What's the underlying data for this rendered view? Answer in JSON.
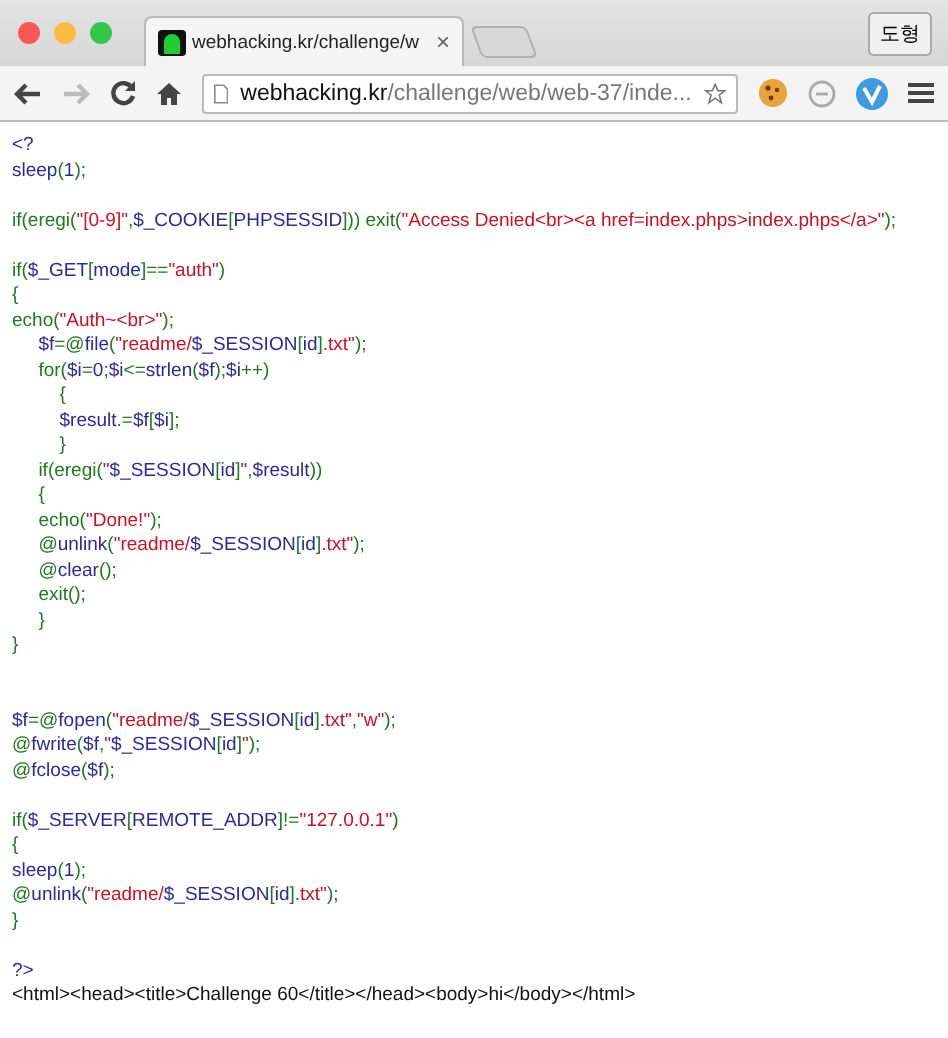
{
  "window": {
    "tab_title": "webhacking.kr/challenge/w",
    "tab_close": "×",
    "profile_button": "도형"
  },
  "toolbar": {
    "url_domain": "webhacking.kr",
    "url_path": "/challenge/web/web-37/inde..."
  },
  "code_lines": [
    {
      "kind": "code",
      "segs": [
        {
          "text": "<?",
          "kind": "ident"
        }
      ]
    },
    {
      "kind": "code",
      "segs": [
        {
          "text": "sleep",
          "kind": "ident"
        },
        {
          "text": "(",
          "kind": "keyword"
        },
        {
          "text": "1",
          "kind": "ident"
        },
        {
          "text": ");",
          "kind": "keyword"
        }
      ]
    },
    {
      "kind": "blank"
    },
    {
      "kind": "code",
      "segs": [
        {
          "text": "if(eregi(",
          "kind": "keyword"
        },
        {
          "text": "\"[0-9]\"",
          "kind": "string"
        },
        {
          "text": ",",
          "kind": "keyword"
        },
        {
          "text": "$_COOKIE",
          "kind": "ident"
        },
        {
          "text": "[",
          "kind": "keyword"
        },
        {
          "text": "PHPSESSID",
          "kind": "ident"
        },
        {
          "text": "])) exit(",
          "kind": "keyword"
        },
        {
          "text": "\"Access Denied<br><a href=index.phps>index.phps</a>\"",
          "kind": "string"
        },
        {
          "text": ");",
          "kind": "keyword"
        }
      ]
    },
    {
      "kind": "blank"
    },
    {
      "kind": "code",
      "segs": [
        {
          "text": "if(",
          "kind": "keyword"
        },
        {
          "text": "$_GET",
          "kind": "ident"
        },
        {
          "text": "[",
          "kind": "keyword"
        },
        {
          "text": "mode",
          "kind": "ident"
        },
        {
          "text": "]==",
          "kind": "keyword"
        },
        {
          "text": "\"auth\"",
          "kind": "string"
        },
        {
          "text": ")",
          "kind": "keyword"
        }
      ]
    },
    {
      "kind": "code",
      "segs": [
        {
          "text": "{",
          "kind": "keyword"
        }
      ]
    },
    {
      "kind": "code",
      "segs": [
        {
          "text": "echo(",
          "kind": "keyword"
        },
        {
          "text": "\"Auth~<br>\"",
          "kind": "string"
        },
        {
          "text": ");",
          "kind": "keyword"
        }
      ]
    },
    {
      "kind": "code",
      "segs": [
        {
          "text": "     $f",
          "kind": "ident"
        },
        {
          "text": "=@",
          "kind": "keyword"
        },
        {
          "text": "file",
          "kind": "ident"
        },
        {
          "text": "(",
          "kind": "keyword"
        },
        {
          "text": "\"readme/",
          "kind": "string"
        },
        {
          "text": "$_SESSION",
          "kind": "ident"
        },
        {
          "text": "[",
          "kind": "keyword"
        },
        {
          "text": "id",
          "kind": "ident"
        },
        {
          "text": "]",
          "kind": "keyword"
        },
        {
          "text": ".txt\"",
          "kind": "string"
        },
        {
          "text": ");",
          "kind": "keyword"
        }
      ]
    },
    {
      "kind": "code",
      "segs": [
        {
          "text": "     for(",
          "kind": "keyword"
        },
        {
          "text": "$i",
          "kind": "ident"
        },
        {
          "text": "=",
          "kind": "keyword"
        },
        {
          "text": "0",
          "kind": "ident"
        },
        {
          "text": ";",
          "kind": "keyword"
        },
        {
          "text": "$i",
          "kind": "ident"
        },
        {
          "text": "<=",
          "kind": "keyword"
        },
        {
          "text": "strlen",
          "kind": "ident"
        },
        {
          "text": "(",
          "kind": "keyword"
        },
        {
          "text": "$f",
          "kind": "ident"
        },
        {
          "text": ");",
          "kind": "keyword"
        },
        {
          "text": "$i",
          "kind": "ident"
        },
        {
          "text": "++)",
          "kind": "keyword"
        }
      ]
    },
    {
      "kind": "code",
      "segs": [
        {
          "text": "         {",
          "kind": "keyword"
        }
      ]
    },
    {
      "kind": "code",
      "segs": [
        {
          "text": "         $result",
          "kind": "ident"
        },
        {
          "text": ".=",
          "kind": "keyword"
        },
        {
          "text": "$f",
          "kind": "ident"
        },
        {
          "text": "[",
          "kind": "keyword"
        },
        {
          "text": "$i",
          "kind": "ident"
        },
        {
          "text": "];",
          "kind": "keyword"
        }
      ]
    },
    {
      "kind": "code",
      "segs": [
        {
          "text": "         }",
          "kind": "keyword"
        }
      ]
    },
    {
      "kind": "code",
      "segs": [
        {
          "text": "     if(eregi(",
          "kind": "keyword"
        },
        {
          "text": "\"",
          "kind": "string"
        },
        {
          "text": "$_SESSION",
          "kind": "ident"
        },
        {
          "text": "[",
          "kind": "keyword"
        },
        {
          "text": "id",
          "kind": "ident"
        },
        {
          "text": "]",
          "kind": "keyword"
        },
        {
          "text": "\"",
          "kind": "string"
        },
        {
          "text": ",",
          "kind": "keyword"
        },
        {
          "text": "$result",
          "kind": "ident"
        },
        {
          "text": "))",
          "kind": "keyword"
        }
      ]
    },
    {
      "kind": "code",
      "segs": [
        {
          "text": "     {",
          "kind": "keyword"
        }
      ]
    },
    {
      "kind": "code",
      "segs": [
        {
          "text": "     echo(",
          "kind": "keyword"
        },
        {
          "text": "\"Done!\"",
          "kind": "string"
        },
        {
          "text": ");",
          "kind": "keyword"
        }
      ]
    },
    {
      "kind": "code",
      "segs": [
        {
          "text": "     @",
          "kind": "keyword"
        },
        {
          "text": "unlink",
          "kind": "ident"
        },
        {
          "text": "(",
          "kind": "keyword"
        },
        {
          "text": "\"readme/",
          "kind": "string"
        },
        {
          "text": "$_SESSION",
          "kind": "ident"
        },
        {
          "text": "[",
          "kind": "keyword"
        },
        {
          "text": "id",
          "kind": "ident"
        },
        {
          "text": "]",
          "kind": "keyword"
        },
        {
          "text": ".txt\"",
          "kind": "string"
        },
        {
          "text": ");",
          "kind": "keyword"
        }
      ]
    },
    {
      "kind": "code",
      "segs": [
        {
          "text": "     @",
          "kind": "keyword"
        },
        {
          "text": "clear",
          "kind": "ident"
        },
        {
          "text": "();",
          "kind": "keyword"
        }
      ]
    },
    {
      "kind": "code",
      "segs": [
        {
          "text": "     exit();",
          "kind": "keyword"
        }
      ]
    },
    {
      "kind": "code",
      "segs": [
        {
          "text": "     }",
          "kind": "keyword"
        }
      ]
    },
    {
      "kind": "code",
      "segs": [
        {
          "text": "}",
          "kind": "keyword"
        }
      ]
    },
    {
      "kind": "blank"
    },
    {
      "kind": "blank"
    },
    {
      "kind": "code",
      "segs": [
        {
          "text": "$f",
          "kind": "ident"
        },
        {
          "text": "=@",
          "kind": "keyword"
        },
        {
          "text": "fopen",
          "kind": "ident"
        },
        {
          "text": "(",
          "kind": "keyword"
        },
        {
          "text": "\"readme/",
          "kind": "string"
        },
        {
          "text": "$_SESSION",
          "kind": "ident"
        },
        {
          "text": "[",
          "kind": "keyword"
        },
        {
          "text": "id",
          "kind": "ident"
        },
        {
          "text": "]",
          "kind": "keyword"
        },
        {
          "text": ".txt\"",
          "kind": "string"
        },
        {
          "text": ",",
          "kind": "keyword"
        },
        {
          "text": "\"w\"",
          "kind": "string"
        },
        {
          "text": ");",
          "kind": "keyword"
        }
      ]
    },
    {
      "kind": "code",
      "segs": [
        {
          "text": "@",
          "kind": "keyword"
        },
        {
          "text": "fwrite",
          "kind": "ident"
        },
        {
          "text": "(",
          "kind": "keyword"
        },
        {
          "text": "$f",
          "kind": "ident"
        },
        {
          "text": ",",
          "kind": "keyword"
        },
        {
          "text": "\"",
          "kind": "string"
        },
        {
          "text": "$_SESSION",
          "kind": "ident"
        },
        {
          "text": "[",
          "kind": "keyword"
        },
        {
          "text": "id",
          "kind": "ident"
        },
        {
          "text": "]",
          "kind": "keyword"
        },
        {
          "text": "\"",
          "kind": "string"
        },
        {
          "text": ");",
          "kind": "keyword"
        }
      ]
    },
    {
      "kind": "code",
      "segs": [
        {
          "text": "@",
          "kind": "keyword"
        },
        {
          "text": "fclose",
          "kind": "ident"
        },
        {
          "text": "(",
          "kind": "keyword"
        },
        {
          "text": "$f",
          "kind": "ident"
        },
        {
          "text": ");",
          "kind": "keyword"
        }
      ]
    },
    {
      "kind": "blank"
    },
    {
      "kind": "code",
      "segs": [
        {
          "text": "if(",
          "kind": "keyword"
        },
        {
          "text": "$_SERVER",
          "kind": "ident"
        },
        {
          "text": "[",
          "kind": "keyword"
        },
        {
          "text": "REMOTE_ADDR",
          "kind": "ident"
        },
        {
          "text": "]!=",
          "kind": "keyword"
        },
        {
          "text": "\"127.0.0.1\"",
          "kind": "string"
        },
        {
          "text": ")",
          "kind": "keyword"
        }
      ]
    },
    {
      "kind": "code",
      "segs": [
        {
          "text": "{",
          "kind": "keyword"
        }
      ]
    },
    {
      "kind": "code",
      "segs": [
        {
          "text": "sleep",
          "kind": "ident"
        },
        {
          "text": "(",
          "kind": "keyword"
        },
        {
          "text": "1",
          "kind": "ident"
        },
        {
          "text": ");",
          "kind": "keyword"
        }
      ]
    },
    {
      "kind": "code",
      "segs": [
        {
          "text": "@",
          "kind": "keyword"
        },
        {
          "text": "unlink",
          "kind": "ident"
        },
        {
          "text": "(",
          "kind": "keyword"
        },
        {
          "text": "\"readme/",
          "kind": "string"
        },
        {
          "text": "$_SESSION",
          "kind": "ident"
        },
        {
          "text": "[",
          "kind": "keyword"
        },
        {
          "text": "id",
          "kind": "ident"
        },
        {
          "text": "]",
          "kind": "keyword"
        },
        {
          "text": ".txt\"",
          "kind": "string"
        },
        {
          "text": ");",
          "kind": "keyword"
        }
      ]
    },
    {
      "kind": "code",
      "segs": [
        {
          "text": "}",
          "kind": "keyword"
        }
      ]
    },
    {
      "kind": "blank"
    },
    {
      "kind": "code",
      "segs": [
        {
          "text": "?>",
          "kind": "ident"
        }
      ]
    },
    {
      "kind": "code",
      "segs": [
        {
          "text": "<html><head><title>Challenge 60</title></head><body>hi</body></html>",
          "kind": "html"
        }
      ]
    }
  ]
}
